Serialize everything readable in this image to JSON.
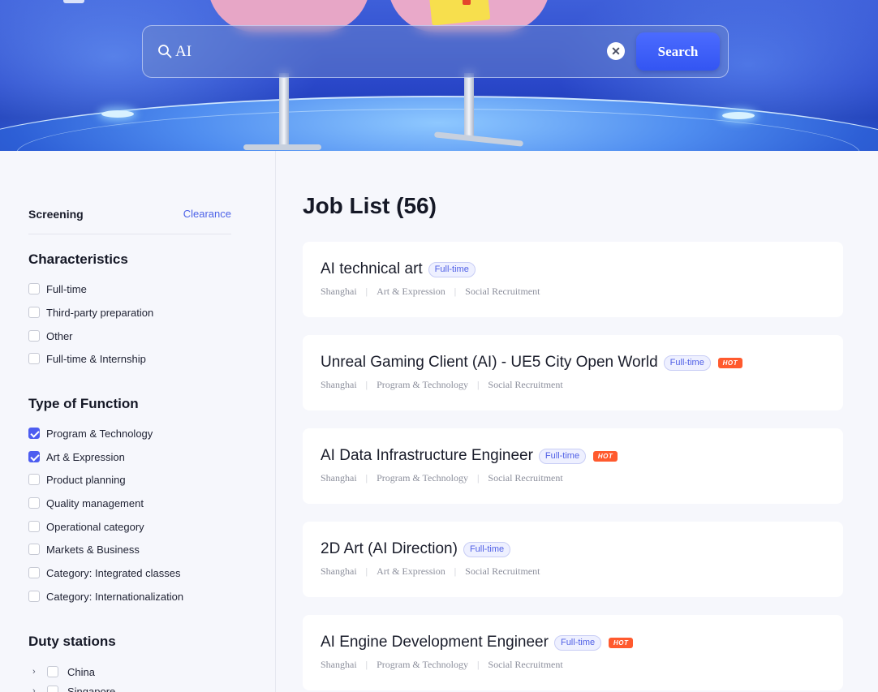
{
  "search": {
    "value": "AI",
    "button_label": "Search"
  },
  "sidebar": {
    "screening_title": "Screening",
    "clear_label": "Clearance",
    "characteristics": {
      "title": "Characteristics",
      "options": [
        {
          "label": "Full-time",
          "checked": false
        },
        {
          "label": "Third-party preparation",
          "checked": false
        },
        {
          "label": "Other",
          "checked": false
        },
        {
          "label": "Full-time & Internship",
          "checked": false
        }
      ]
    },
    "function": {
      "title": "Type of Function",
      "options": [
        {
          "label": "Program & Technology",
          "checked": true
        },
        {
          "label": "Art & Expression",
          "checked": true
        },
        {
          "label": "Product planning",
          "checked": false
        },
        {
          "label": "Quality management",
          "checked": false
        },
        {
          "label": "Operational category",
          "checked": false
        },
        {
          "label": "Markets & Business",
          "checked": false
        },
        {
          "label": "Category: Integrated classes",
          "checked": false
        },
        {
          "label": "Category: Internationalization",
          "checked": false
        }
      ]
    },
    "duty": {
      "title": "Duty stations",
      "options": [
        {
          "label": "China",
          "checked": false
        },
        {
          "label": "Singapore",
          "checked": false
        }
      ]
    }
  },
  "main": {
    "list_title": "Job List (56)",
    "jobs": [
      {
        "title": "AI technical art",
        "type": "Full-time",
        "hot": false,
        "city": "Shanghai",
        "function": "Art & Expression",
        "recruitment": "Social Recruitment"
      },
      {
        "title": "Unreal Gaming Client (AI) - UE5 City Open World",
        "type": "Full-time",
        "hot": true,
        "city": "Shanghai",
        "function": "Program & Technology",
        "recruitment": "Social Recruitment"
      },
      {
        "title": "AI Data Infrastructure Engineer",
        "type": "Full-time",
        "hot": true,
        "city": "Shanghai",
        "function": "Program & Technology",
        "recruitment": "Social Recruitment"
      },
      {
        "title": "2D Art (AI Direction)",
        "type": "Full-time",
        "hot": false,
        "city": "Shanghai",
        "function": "Art & Expression",
        "recruitment": "Social Recruitment"
      },
      {
        "title": "AI Engine Development Engineer",
        "type": "Full-time",
        "hot": true,
        "city": "Shanghai",
        "function": "Program & Technology",
        "recruitment": "Social Recruitment"
      }
    ],
    "hot_label": "HOT"
  },
  "colors": {
    "accent": "#4d5df0",
    "hot": "#ff5a2e",
    "search_button": "#3f5ff7"
  },
  "icons": {
    "search": "search-icon",
    "clear": "close-icon",
    "expand": "chevron-right-icon",
    "hot": "hot-badge-icon"
  }
}
